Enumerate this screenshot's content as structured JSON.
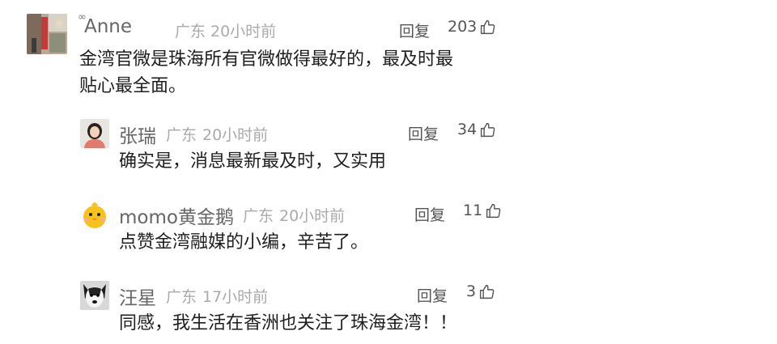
{
  "comments": [
    {
      "user": "Anne",
      "location": "广东",
      "time": "20小时前",
      "reply_label": "回复",
      "likes": "203",
      "text_lines": [
        "金湾官微是珠海所有官微做得最好的，最及时最",
        "贴心最全面。"
      ],
      "avatar_icon": "street-photo-avatar",
      "decoration_icon": "infinity-badge-icon"
    },
    {
      "user": "张瑞",
      "location": "广东",
      "time": "20小时前",
      "reply_label": "回复",
      "likes": "34",
      "text_lines": [
        "确实是，消息最新最及时，又实用"
      ],
      "avatar_icon": "portrait-photo-avatar"
    },
    {
      "user": "momo黄金鹅",
      "location": "广东",
      "time": "20小时前",
      "reply_label": "回复",
      "likes": "11",
      "text_lines": [
        "点赞金湾融媒的小编，辛苦了。"
      ],
      "avatar_icon": "yellow-chick-avatar"
    },
    {
      "user": "汪星",
      "location": "广东",
      "time": "17小时前",
      "reply_label": "回复",
      "likes": "3",
      "text_lines": [
        "同感，我生活在香洲也关注了珠海金湾！！"
      ],
      "avatar_icon": "dog-photo-avatar"
    }
  ],
  "like_icon": "thumbs-up-icon",
  "colors": {
    "meta_gray": "#aaaaaa",
    "username_gray": "#666666",
    "text": "#1e1e1e"
  }
}
